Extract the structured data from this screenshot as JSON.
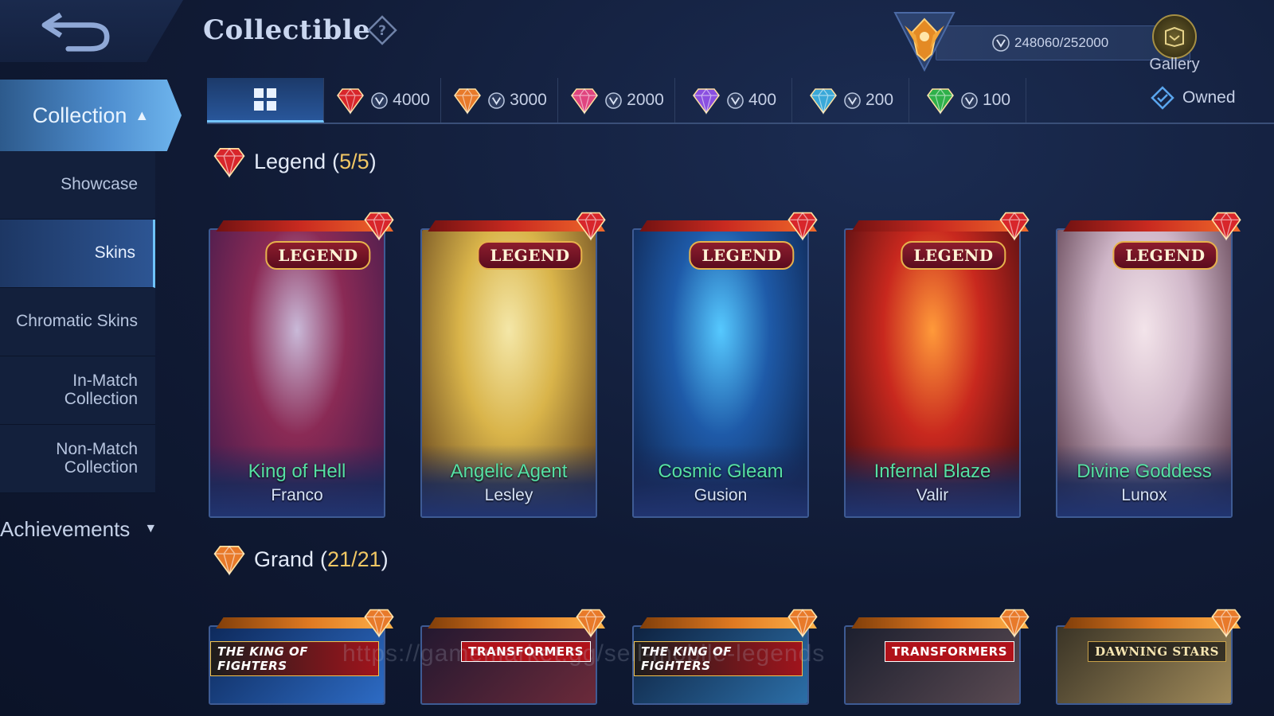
{
  "header": {
    "title": "Collectible",
    "currency_value": "248060/252000",
    "gallery_label": "Gallery"
  },
  "sidebar": {
    "collection_label": "Collection",
    "items": [
      {
        "label": "Showcase"
      },
      {
        "label": "Skins"
      },
      {
        "label": "Chromatic Skins"
      },
      {
        "label_line1": "In-Match",
        "label_line2": "Collection"
      },
      {
        "label_line1": "Non-Match",
        "label_line2": "Collection"
      }
    ],
    "achievements_label": "Achievements"
  },
  "tabs": [
    {
      "icon": "grid-icon"
    },
    {
      "icon": "legend-gem-icon",
      "value": "4000",
      "color": "#d8262b"
    },
    {
      "icon": "grand-gem-icon",
      "value": "3000",
      "color": "#e87a2a"
    },
    {
      "icon": "exquisite-gem-icon",
      "value": "2000",
      "color": "#e0457f"
    },
    {
      "icon": "deluxe-gem-icon",
      "value": "400",
      "color": "#8a4fe0"
    },
    {
      "icon": "exceptional-gem-icon",
      "value": "200",
      "color": "#3aa8d8"
    },
    {
      "icon": "common-gem-icon",
      "value": "100",
      "color": "#2fb04a"
    }
  ],
  "owned_label": "Owned",
  "legend_section": {
    "label": "Legend",
    "count": "5/5",
    "badge": "LEGEND",
    "cards": [
      {
        "skin": "King of Hell",
        "hero": "Franco",
        "art": [
          "#3b1a4c",
          "#8a2a55",
          "#c9b9d8"
        ]
      },
      {
        "skin": "Angelic Agent",
        "hero": "Lesley",
        "art": [
          "#5a3a1a",
          "#d9b44a",
          "#f4e7a8"
        ]
      },
      {
        "skin": "Cosmic Gleam",
        "hero": "Gusion",
        "art": [
          "#0d1c40",
          "#1e5aa8",
          "#56c9ff"
        ]
      },
      {
        "skin": "Infernal Blaze",
        "hero": "Valir",
        "art": [
          "#3a0a10",
          "#c8281e",
          "#ff9a3a"
        ]
      },
      {
        "skin": "Divine Goddess",
        "hero": "Lunox",
        "art": [
          "#4a2a3a",
          "#cfb6c8",
          "#f3e4ea"
        ]
      }
    ]
  },
  "grand_section": {
    "label": "Grand",
    "count": "21/21",
    "cards": [
      {
        "brand": "THE KING OF FIGHTERS",
        "brand_class": "kof",
        "art": [
          "#0e2a5c",
          "#2d6bc4"
        ]
      },
      {
        "brand": "TRANSFORMERS",
        "brand_class": "tf",
        "art": [
          "#231830",
          "#6b2a3a"
        ]
      },
      {
        "brand": "THE KING OF FIGHTERS",
        "brand_class": "kof",
        "art": [
          "#0e2240",
          "#2c6fa8"
        ]
      },
      {
        "brand": "TRANSFORMERS",
        "brand_class": "tf",
        "art": [
          "#1c1f2e",
          "#5a4a52"
        ]
      },
      {
        "brand": "DAWNING STARS",
        "brand_class": "dawn",
        "art": [
          "#3a3426",
          "#a08a5a"
        ]
      }
    ]
  },
  "watermark": "https://gamemarket.gg/sell-mobile-legends"
}
